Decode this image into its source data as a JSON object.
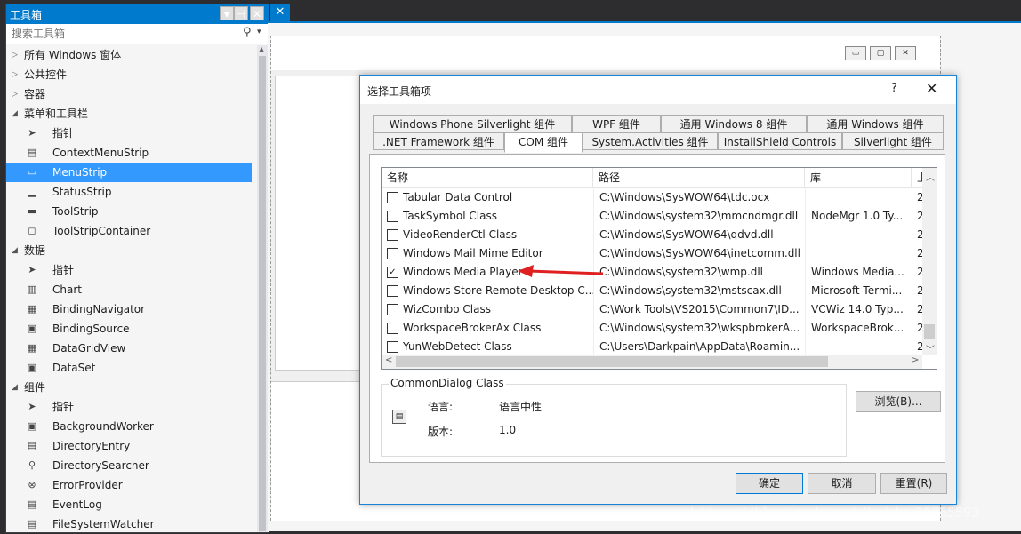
{
  "toolbox": {
    "title": "工具箱",
    "pin_glyph": "▾",
    "dock_glyph": "⊣",
    "close_glyph": "✕",
    "search_placeholder": "搜索工具箱",
    "search_icon": "search-icon",
    "items": [
      {
        "type": "cat",
        "expanded": false,
        "label": "所有 Windows 窗体"
      },
      {
        "type": "cat",
        "expanded": false,
        "label": "公共控件"
      },
      {
        "type": "cat",
        "expanded": false,
        "label": "容器"
      },
      {
        "type": "cat",
        "expanded": true,
        "label": "菜单和工具栏"
      },
      {
        "type": "item",
        "icon": "pointer-icon",
        "glyph": "➤",
        "label": "指针"
      },
      {
        "type": "item",
        "icon": "context-menu-icon",
        "glyph": "▤",
        "label": "ContextMenuStrip"
      },
      {
        "type": "item",
        "icon": "menu-strip-icon",
        "glyph": "▭",
        "label": "MenuStrip",
        "selected": true
      },
      {
        "type": "item",
        "icon": "status-strip-icon",
        "glyph": "▁",
        "label": "StatusStrip"
      },
      {
        "type": "item",
        "icon": "tool-strip-icon",
        "glyph": "▬",
        "label": "ToolStrip"
      },
      {
        "type": "item",
        "icon": "tool-strip-container-icon",
        "glyph": "◻",
        "label": "ToolStripContainer"
      },
      {
        "type": "cat",
        "expanded": true,
        "label": "数据"
      },
      {
        "type": "item",
        "icon": "pointer-icon",
        "glyph": "➤",
        "label": "指针"
      },
      {
        "type": "item",
        "icon": "chart-icon",
        "glyph": "▥",
        "label": "Chart"
      },
      {
        "type": "item",
        "icon": "binding-navigator-icon",
        "glyph": "▦",
        "label": "BindingNavigator"
      },
      {
        "type": "item",
        "icon": "binding-source-icon",
        "glyph": "▣",
        "label": "BindingSource"
      },
      {
        "type": "item",
        "icon": "data-grid-view-icon",
        "glyph": "▦",
        "label": "DataGridView"
      },
      {
        "type": "item",
        "icon": "data-set-icon",
        "glyph": "▣",
        "label": "DataSet"
      },
      {
        "type": "cat",
        "expanded": true,
        "label": "组件"
      },
      {
        "type": "item",
        "icon": "pointer-icon",
        "glyph": "➤",
        "label": "指针"
      },
      {
        "type": "item",
        "icon": "background-worker-icon",
        "glyph": "▣",
        "label": "BackgroundWorker"
      },
      {
        "type": "item",
        "icon": "directory-entry-icon",
        "glyph": "▤",
        "label": "DirectoryEntry"
      },
      {
        "type": "item",
        "icon": "directory-searcher-icon",
        "glyph": "⚲",
        "label": "DirectorySearcher"
      },
      {
        "type": "item",
        "icon": "error-provider-icon",
        "glyph": "⊗",
        "label": "ErrorProvider"
      },
      {
        "type": "item",
        "icon": "event-log-icon",
        "glyph": "▤",
        "label": "EventLog"
      },
      {
        "type": "item",
        "icon": "file-system-watcher-icon",
        "glyph": "▤",
        "label": "FileSystemWatcher"
      }
    ]
  },
  "editor": {
    "close_glyph": "✕"
  },
  "form": {
    "min_glyph": "▭",
    "max_glyph": "▢",
    "close_glyph": "✕"
  },
  "dialog": {
    "title": "选择工具箱项",
    "help": "?",
    "close": "✕",
    "tabs_row1": [
      "Windows Phone Silverlight 组件",
      "WPF 组件",
      "通用 Windows 8 组件",
      "通用 Windows 组件"
    ],
    "tabs_row2": [
      ".NET Framework 组件",
      "COM 组件",
      "System.Activities 组件",
      "InstallShield Controls",
      "Silverlight 组件"
    ],
    "active_tab": "COM 组件",
    "columns": [
      "名称",
      "路径",
      "库",
      "上"
    ],
    "rows": [
      {
        "checked": false,
        "name": "Tabular Data Control",
        "path": "C:\\Windows\\SysWOW64\\tdc.ocx",
        "lib": "",
        "ver": "2"
      },
      {
        "checked": false,
        "name": "TaskSymbol Class",
        "path": "C:\\Windows\\system32\\mmcndmgr.dll",
        "lib": "NodeMgr 1.0 Ty...",
        "ver": "2"
      },
      {
        "checked": false,
        "name": "VideoRenderCtl Class",
        "path": "C:\\Windows\\SysWOW64\\qdvd.dll",
        "lib": "",
        "ver": "2"
      },
      {
        "checked": false,
        "name": "Windows Mail Mime Editor",
        "path": "C:\\Windows\\SysWOW64\\inetcomm.dll",
        "lib": "",
        "ver": "2"
      },
      {
        "checked": true,
        "name": "Windows Media Player",
        "path": "C:\\Windows\\system32\\wmp.dll",
        "lib": "Windows Media...",
        "ver": "2"
      },
      {
        "checked": false,
        "name": "Windows Store Remote Desktop C...",
        "path": "C:\\Windows\\system32\\mstscax.dll",
        "lib": "Microsoft Termi...",
        "ver": "2"
      },
      {
        "checked": false,
        "name": "WizCombo Class",
        "path": "C:\\Work Tools\\VS2015\\Common7\\ID...",
        "lib": "VCWiz 14.0 Typ...",
        "ver": "2"
      },
      {
        "checked": false,
        "name": "WorkspaceBrokerAx Class",
        "path": "C:\\Windows\\system32\\wkspbrokerA...",
        "lib": "WorkspaceBrok...",
        "ver": "2"
      },
      {
        "checked": false,
        "name": "YunWebDetect Class",
        "path": "C:\\Users\\Darkpain\\AppData\\Roamin...",
        "lib": "",
        "ver": "2"
      }
    ],
    "details": {
      "title": "CommonDialog Class",
      "language_label": "语言:",
      "language_value": "语言中性",
      "version_label": "版本:",
      "version_value": "1.0",
      "icon": "component-icon"
    },
    "browse": "浏览(B)...",
    "ok": "确定",
    "cancel": "取消",
    "reset": "重置(R)"
  },
  "watermark": "https://blog.csdn.net/baidu_36765593",
  "colors": {
    "accent": "#007acc",
    "selection": "#3399ff",
    "arrow": "#e02020"
  }
}
